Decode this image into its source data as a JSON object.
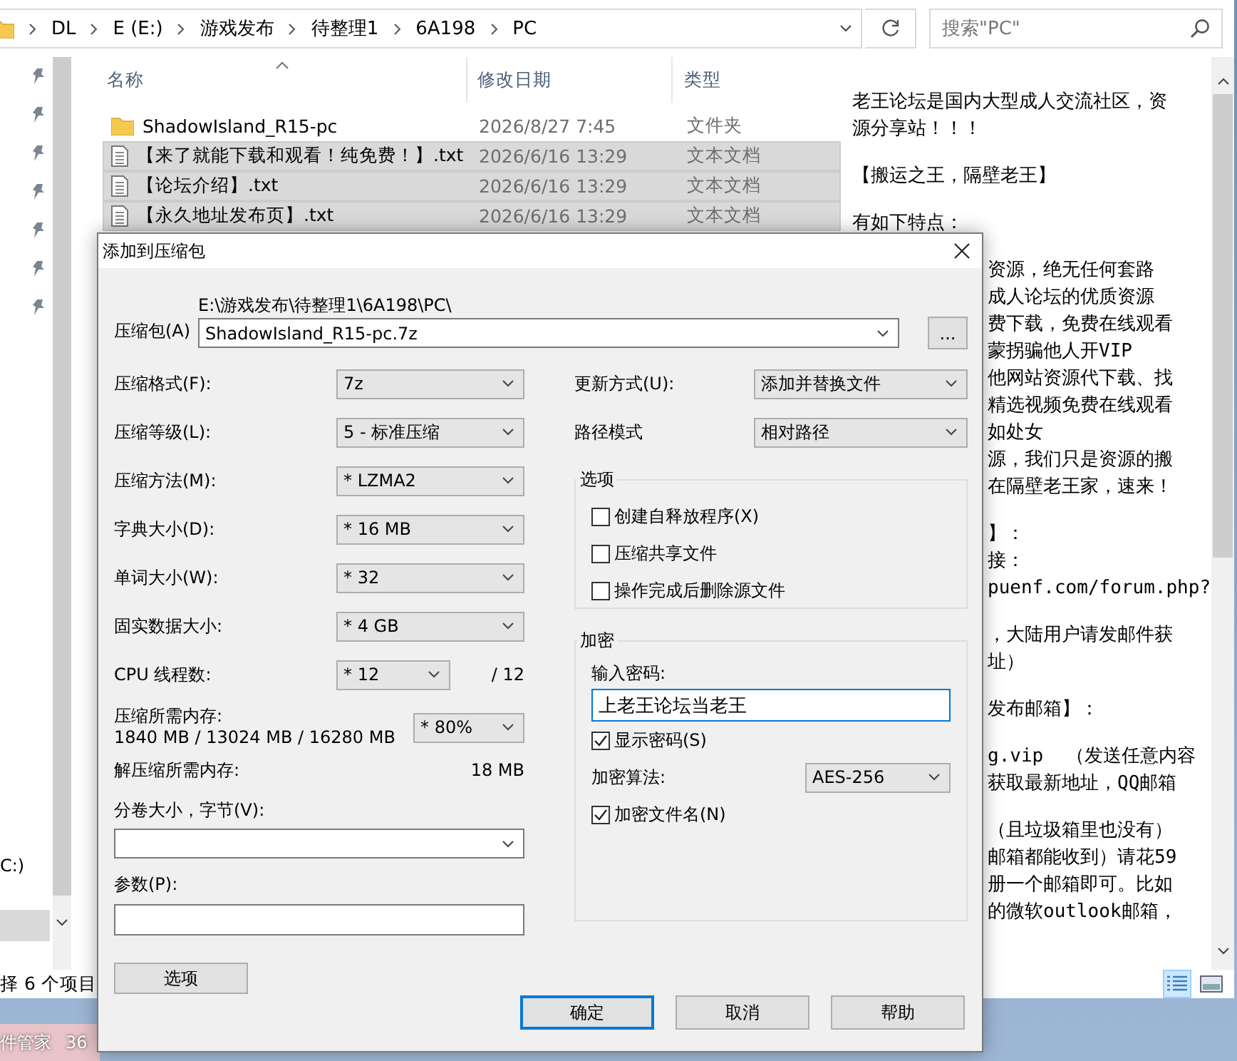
{
  "explorer": {
    "breadcrumbs": [
      "DL",
      "E (E:)",
      "游戏发布",
      "待整理1",
      "6A198",
      "PC"
    ],
    "search": {
      "placeholder": "搜索\"PC\""
    },
    "nav_items": [
      "C:)"
    ],
    "columns": [
      "名称",
      "修改日期",
      "类型"
    ],
    "files": [
      {
        "kind": "folder",
        "name": "ShadowIsland_R15-pc",
        "date": "2026/8/27 7:45",
        "type": "文件夹",
        "selected": false
      },
      {
        "kind": "text",
        "name": "【来了就能下载和观看！纯免费！】.txt",
        "date": "2026/6/16 13:29",
        "type": "文本文档",
        "selected": true
      },
      {
        "kind": "text",
        "name": "【论坛介绍】.txt",
        "date": "2026/6/16 13:29",
        "type": "文本文档",
        "selected": true
      },
      {
        "kind": "text",
        "name": "【永久地址发布页】.txt",
        "date": "2026/6/16 13:29",
        "type": "文本文档",
        "selected": true
      }
    ],
    "preview": {
      "full": [
        {
          "lines": [
            "老王论坛是国内大型成人交流社区，资",
            "源分享站！！！"
          ]
        },
        {
          "lines": [
            "【搬运之王，隔壁老王】"
          ]
        },
        {
          "lines": [
            "有如下特点："
          ]
        }
      ],
      "beside_dialog": [
        {
          "lines": [
            "资源，绝无任何套路",
            "成人论坛的优质资源",
            "费下载，免费在线观看",
            "蒙拐骗他人开VIP",
            "他网站资源代下载、找",
            "精选视频免费在线观看",
            "如处女",
            "源，我们只是资源的搬",
            "在隔壁老王家，速来！"
          ]
        },
        {
          "lines": [
            "】：",
            "接：",
            "puenf.com/forum.php?"
          ]
        },
        {
          "lines": [
            "，大陆用户请发邮件获",
            "址）"
          ]
        },
        {
          "lines": [
            "发布邮箱】："
          ]
        },
        {
          "lines": [
            "g.vip  （发送任意内容",
            "获取最新地址，QQ邮箱"
          ]
        },
        {
          "lines": [
            "（且垃圾箱里也没有）",
            "邮箱都能收到）请花59",
            "册一个邮箱即可。比如",
            "的微软outlook邮箱，"
          ]
        }
      ]
    },
    "status_bar": {
      "text": "择 6 个项目",
      "view_buttons": [
        {
          "selected": true
        },
        {
          "selected": false
        }
      ]
    }
  },
  "taskbar": {
    "items": [
      "件管家",
      "36"
    ]
  },
  "dialog": {
    "title": "添加到压缩包",
    "archive": {
      "label": "压缩包(A)",
      "folder": "E:\\游戏发布\\待整理1\\6A198\\PC\\",
      "value": "ShadowIsland_R15-pc.7z",
      "browse": "..."
    },
    "left": [
      {
        "kind": "combo",
        "label": "压缩格式(F):",
        "value": "7z"
      },
      {
        "kind": "combo",
        "label": "压缩等级(L):",
        "value": "5 - 标准压缩"
      },
      {
        "kind": "combo",
        "label": "压缩方法(M):",
        "value": "* LZMA2"
      },
      {
        "kind": "combo",
        "label": "字典大小(D):",
        "value": "* 16 MB"
      },
      {
        "kind": "combo",
        "label": "单词大小(W):",
        "value": "* 32"
      },
      {
        "kind": "combo",
        "label": "固实数据大小:",
        "value": "* 4 GB"
      },
      {
        "kind": "combo_short",
        "label": "CPU 线程数:",
        "value": "* 12",
        "suffix": "/ 12"
      },
      {
        "kind": "memory",
        "label": "压缩所需内存:",
        "detail": "1840 MB / 13024 MB / 16280 MB",
        "value": "* 80%"
      },
      {
        "kind": "reading",
        "label": "解压缩所需内存:",
        "value": "18 MB"
      },
      {
        "kind": "wide_combo",
        "label": "分卷大小，字节(V):"
      },
      {
        "kind": "wide_input",
        "label": "参数(P):"
      }
    ],
    "options_button": "选项",
    "right": [
      {
        "label": "更新方式(U):",
        "value": "添加并替换文件"
      },
      {
        "label": "路径模式",
        "value": "相对路径"
      }
    ],
    "options_group": {
      "title": "选项",
      "checkboxes": [
        {
          "label": "创建自释放程序(X)",
          "checked": false
        },
        {
          "label": "压缩共享文件",
          "checked": false
        },
        {
          "label": "操作完成后删除源文件",
          "checked": false
        }
      ]
    },
    "encryption": {
      "title": "加密",
      "password_label": "输入密码:",
      "password": "上老王论坛当老王",
      "show_password": {
        "label": "显示密码(S)",
        "checked": true
      },
      "method_label": "加密算法:",
      "method": "AES-256",
      "encrypt_names": {
        "label": "加密文件名(N)",
        "checked": true
      }
    },
    "buttons": [
      {
        "label": "确定",
        "default": true
      },
      {
        "label": "取消",
        "default": false
      },
      {
        "label": "帮助",
        "default": false
      }
    ]
  }
}
